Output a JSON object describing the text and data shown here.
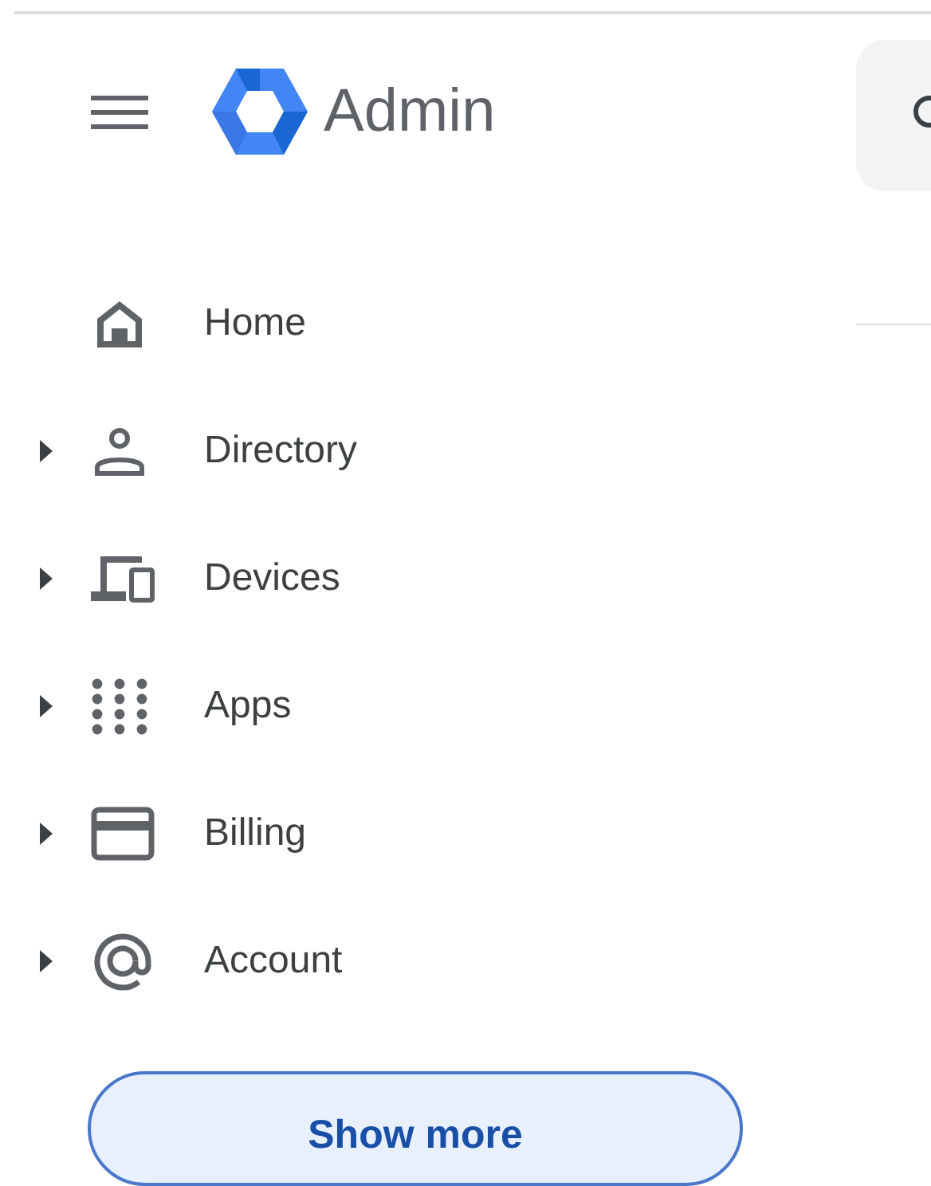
{
  "header": {
    "title": "Admin"
  },
  "nav": {
    "items": [
      {
        "label": "Home",
        "expandable": false
      },
      {
        "label": "Directory",
        "expandable": true
      },
      {
        "label": "Devices",
        "expandable": true
      },
      {
        "label": "Apps",
        "expandable": true
      },
      {
        "label": "Billing",
        "expandable": true
      },
      {
        "label": "Account",
        "expandable": true
      }
    ]
  },
  "show_more_button": {
    "label": "Show more"
  }
}
